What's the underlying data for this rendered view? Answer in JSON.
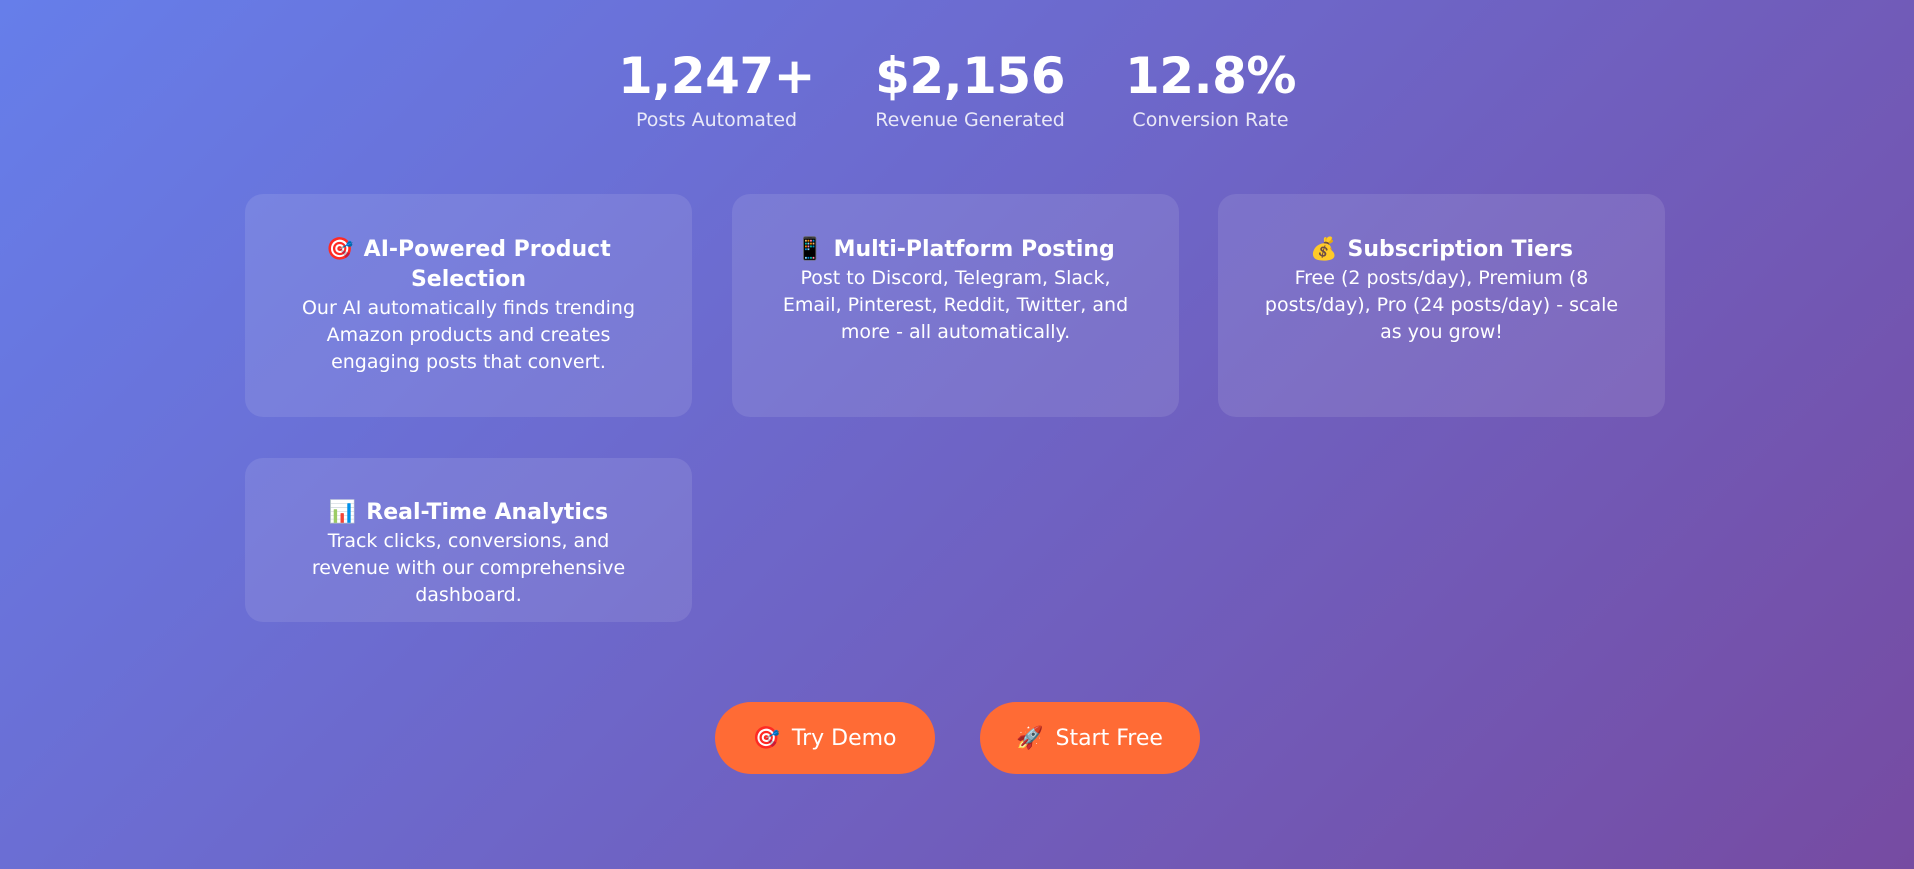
{
  "stats": [
    {
      "value": "1,247+",
      "label": "Posts Automated"
    },
    {
      "value": "$2,156",
      "label": "Revenue Generated"
    },
    {
      "value": "12.8%",
      "label": "Conversion Rate"
    }
  ],
  "features": {
    "ai": {
      "icon": "🎯",
      "icon_name": "target-icon",
      "title": "AI-Powered Product Selection",
      "description": "Our AI automatically finds trending Amazon products and creates engaging posts that convert."
    },
    "platform": {
      "icon": "📱",
      "icon_name": "mobile-phone-icon",
      "title": "Multi-Platform Posting",
      "description": "Post to Discord, Telegram, Slack, Email, Pinterest, Reddit, Twitter, and more - all automatically."
    },
    "tiers": {
      "icon": "💰",
      "icon_name": "money-bag-icon",
      "title": "Subscription Tiers",
      "description": "Free (2 posts/day), Premium (8 posts/day), Pro (24 posts/day) - scale as you grow!"
    },
    "analytics": {
      "icon": "📊",
      "icon_name": "bar-chart-icon",
      "title": "Real-Time Analytics",
      "description": "Track clicks, conversions, and revenue with our comprehensive dashboard."
    }
  },
  "cta": {
    "demo": {
      "icon": "🎯",
      "icon_name": "target-icon",
      "label": "Try Demo"
    },
    "start": {
      "icon": "🚀",
      "icon_name": "rocket-icon",
      "label": "Start Free"
    }
  },
  "colors": {
    "background_start": "#667eea",
    "background_end": "#764ba2",
    "button": "#ff6b35"
  }
}
